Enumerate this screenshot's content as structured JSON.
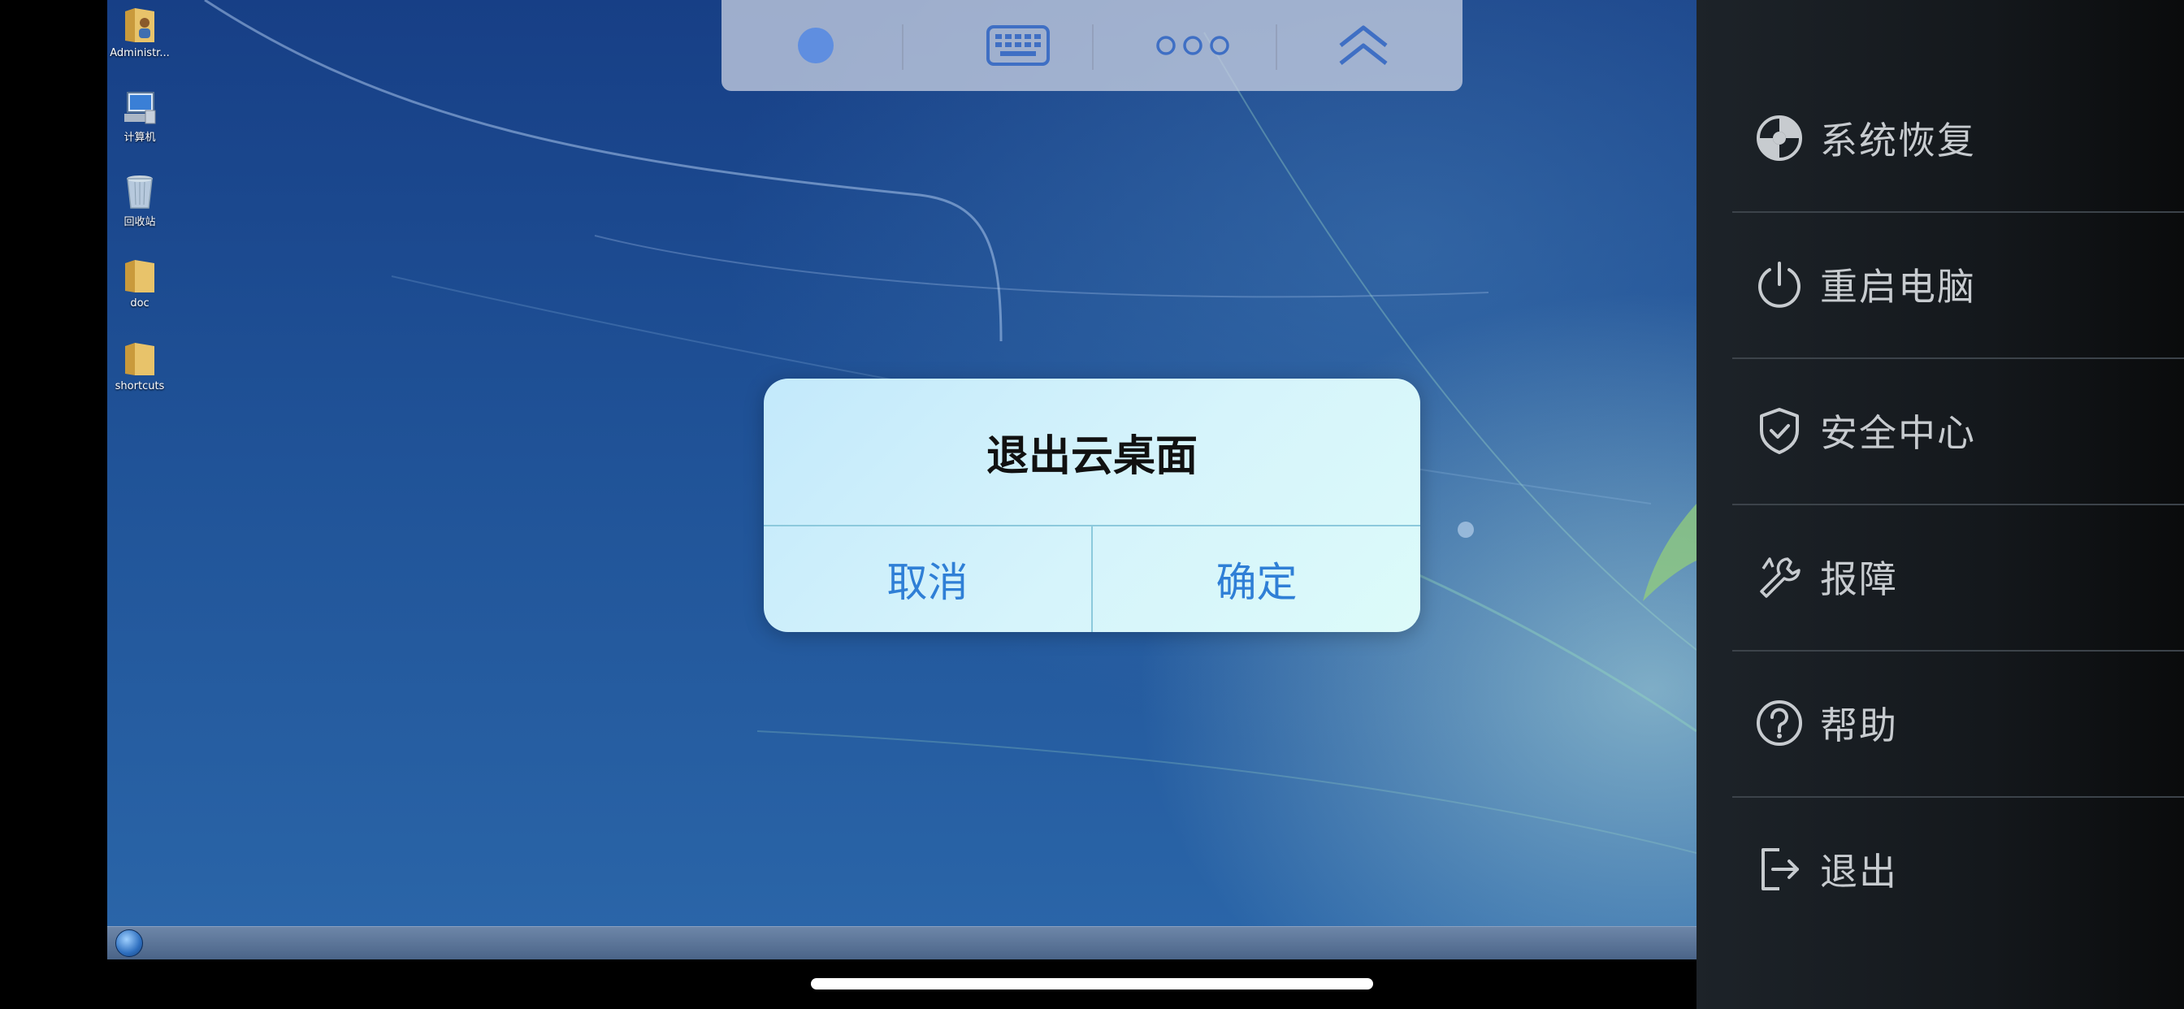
{
  "desktop": {
    "icons": [
      {
        "label": "Administr...",
        "icon": "user-folder-icon"
      },
      {
        "label": "计算机",
        "icon": "computer-icon"
      },
      {
        "label": "回收站",
        "icon": "recycle-bin-icon"
      },
      {
        "label": "doc",
        "icon": "folder-icon"
      },
      {
        "label": "shortcuts",
        "icon": "folder-icon"
      }
    ]
  },
  "toolbar": {
    "buttons": [
      {
        "icon": "circle-icon"
      },
      {
        "icon": "keyboard-icon"
      },
      {
        "icon": "more-dots-icon"
      },
      {
        "icon": "chevron-up-icon"
      }
    ]
  },
  "dialog": {
    "title": "退出云桌面",
    "cancel_label": "取消",
    "confirm_label": "确定"
  },
  "menu": {
    "items": [
      {
        "label": "系统恢复",
        "icon": "system-restore-icon"
      },
      {
        "label": "重启电脑",
        "icon": "power-icon"
      },
      {
        "label": "安全中心",
        "icon": "shield-icon"
      },
      {
        "label": "报障",
        "icon": "repair-wrench-icon"
      },
      {
        "label": "帮助",
        "icon": "help-icon"
      },
      {
        "label": "退出",
        "icon": "exit-icon"
      }
    ]
  },
  "colors": {
    "dialog_button_text": "#2f7fd6",
    "menu_text": "#c7cbcf",
    "menu_background": "#1d2329"
  }
}
